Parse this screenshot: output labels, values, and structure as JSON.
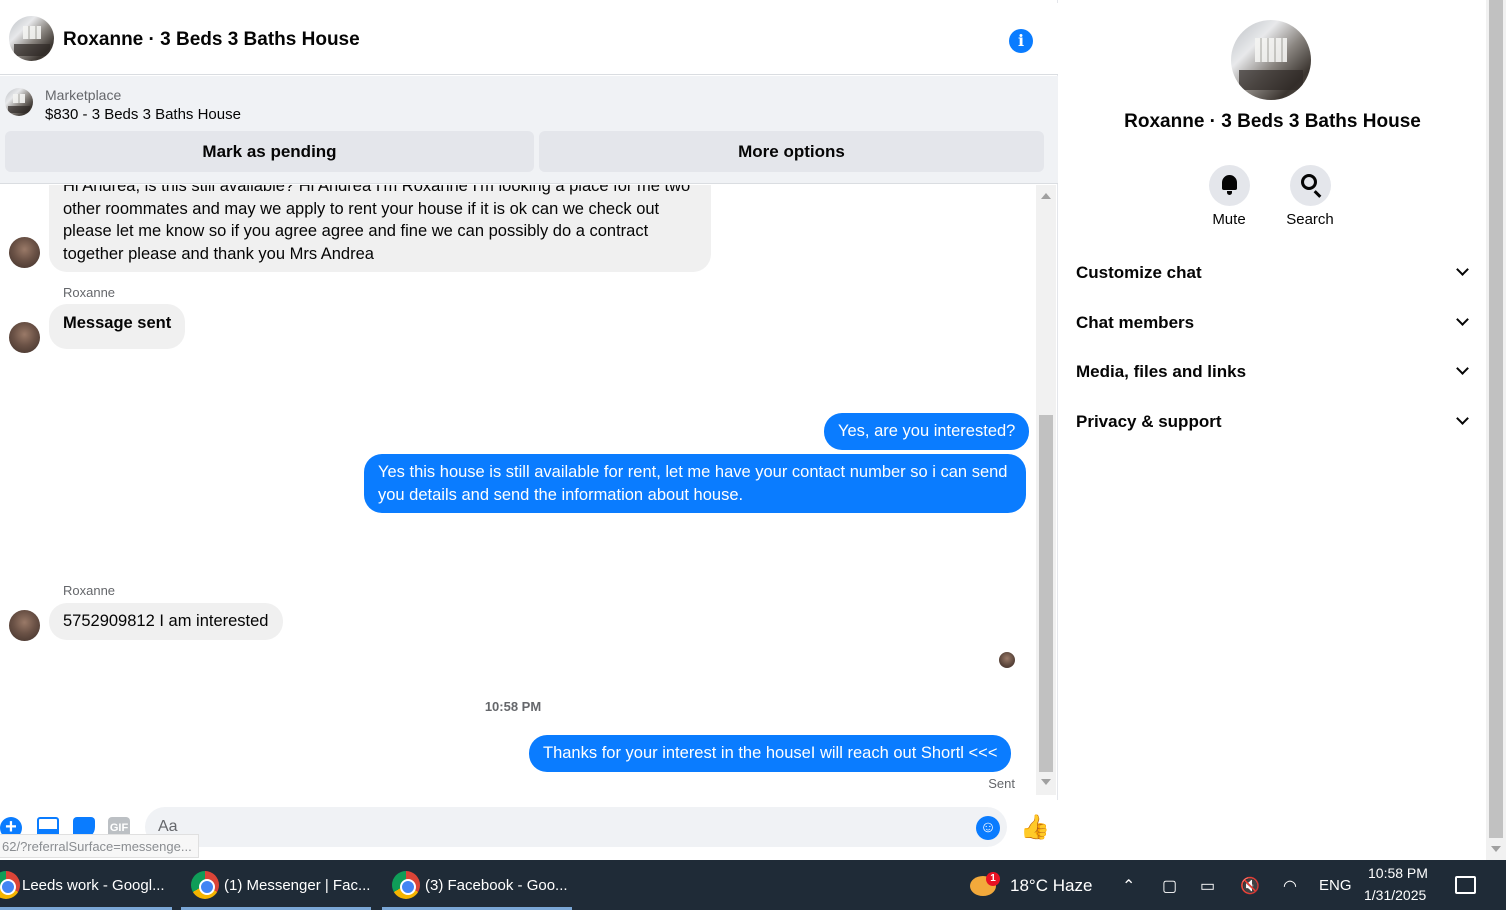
{
  "header": {
    "title": "Roxanne · 3 Beds 3 Baths House",
    "info_icon": "i"
  },
  "marketplace": {
    "label": "Marketplace",
    "listing": "$830 - 3 Beds 3 Baths House",
    "pending_button": "Mark as pending",
    "more_button": "More options"
  },
  "messages": {
    "first": "Hi Andrea, is this still available? Hi Andrea I'm Roxanne I'm looking a place for me two other roommates and may we apply to rent your house if it is ok can we check out please let me know so if you agree agree and fine we can possibly do a contract together please and thank you Mrs Andrea",
    "sender_1": "Roxanne",
    "second": "Message sent",
    "out_1": "Yes, are you interested?",
    "out_2": "Yes this house is still available for rent, let me have your contact number so i can send you details and send the information about house.",
    "sender_2": "Roxanne",
    "third": "5752909812 I am interested",
    "timestamp": "10:58 PM",
    "out_3": "Thanks for your interest in the houseI will reach out Shortl <<<",
    "status": "Sent"
  },
  "composer": {
    "placeholder": "Aa",
    "gif_label": "GIF",
    "url_tooltip": "62/?referralSurface=messenge..."
  },
  "info_pane": {
    "title": "Roxanne · 3 Beds 3 Baths House",
    "mute_label": "Mute",
    "search_label": "Search",
    "sections": [
      {
        "label": "Customize chat"
      },
      {
        "label": "Chat members"
      },
      {
        "label": "Media, files and links"
      },
      {
        "label": "Privacy & support"
      }
    ]
  },
  "taskbar": {
    "tasks": [
      {
        "label": "Leeds work - Googl..."
      },
      {
        "label": "(1) Messenger | Fac..."
      },
      {
        "label": "(3) Facebook - Goo..."
      }
    ],
    "weather": "18°C  Haze",
    "weather_badge": "1",
    "language": "ENG",
    "time": "10:58 PM",
    "date": "1/31/2025"
  },
  "colors": {
    "accent": "#0a7cff",
    "incoming_bubble": "#f0f0f0",
    "taskbar": "#1f2b37"
  }
}
